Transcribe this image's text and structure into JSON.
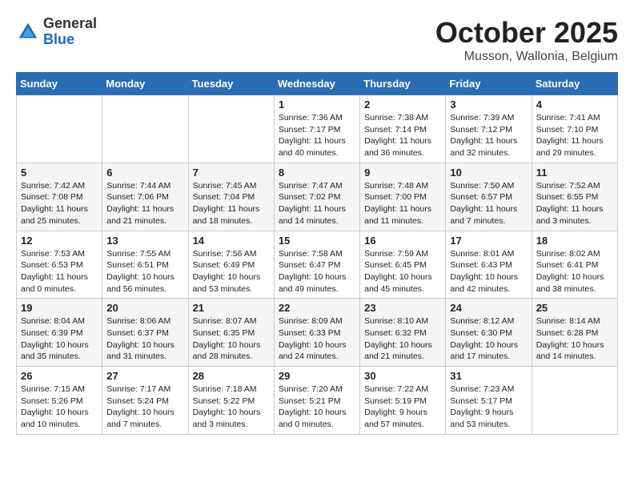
{
  "header": {
    "logo_general": "General",
    "logo_blue": "Blue",
    "month": "October 2025",
    "location": "Musson, Wallonia, Belgium"
  },
  "days_of_week": [
    "Sunday",
    "Monday",
    "Tuesday",
    "Wednesday",
    "Thursday",
    "Friday",
    "Saturday"
  ],
  "weeks": [
    [
      {
        "day": "",
        "info": ""
      },
      {
        "day": "",
        "info": ""
      },
      {
        "day": "",
        "info": ""
      },
      {
        "day": "1",
        "info": "Sunrise: 7:36 AM\nSunset: 7:17 PM\nDaylight: 11 hours and 40 minutes."
      },
      {
        "day": "2",
        "info": "Sunrise: 7:38 AM\nSunset: 7:14 PM\nDaylight: 11 hours and 36 minutes."
      },
      {
        "day": "3",
        "info": "Sunrise: 7:39 AM\nSunset: 7:12 PM\nDaylight: 11 hours and 32 minutes."
      },
      {
        "day": "4",
        "info": "Sunrise: 7:41 AM\nSunset: 7:10 PM\nDaylight: 11 hours and 29 minutes."
      }
    ],
    [
      {
        "day": "5",
        "info": "Sunrise: 7:42 AM\nSunset: 7:08 PM\nDaylight: 11 hours and 25 minutes."
      },
      {
        "day": "6",
        "info": "Sunrise: 7:44 AM\nSunset: 7:06 PM\nDaylight: 11 hours and 21 minutes."
      },
      {
        "day": "7",
        "info": "Sunrise: 7:45 AM\nSunset: 7:04 PM\nDaylight: 11 hours and 18 minutes."
      },
      {
        "day": "8",
        "info": "Sunrise: 7:47 AM\nSunset: 7:02 PM\nDaylight: 11 hours and 14 minutes."
      },
      {
        "day": "9",
        "info": "Sunrise: 7:48 AM\nSunset: 7:00 PM\nDaylight: 11 hours and 11 minutes."
      },
      {
        "day": "10",
        "info": "Sunrise: 7:50 AM\nSunset: 6:57 PM\nDaylight: 11 hours and 7 minutes."
      },
      {
        "day": "11",
        "info": "Sunrise: 7:52 AM\nSunset: 6:55 PM\nDaylight: 11 hours and 3 minutes."
      }
    ],
    [
      {
        "day": "12",
        "info": "Sunrise: 7:53 AM\nSunset: 6:53 PM\nDaylight: 11 hours and 0 minutes."
      },
      {
        "day": "13",
        "info": "Sunrise: 7:55 AM\nSunset: 6:51 PM\nDaylight: 10 hours and 56 minutes."
      },
      {
        "day": "14",
        "info": "Sunrise: 7:56 AM\nSunset: 6:49 PM\nDaylight: 10 hours and 53 minutes."
      },
      {
        "day": "15",
        "info": "Sunrise: 7:58 AM\nSunset: 6:47 PM\nDaylight: 10 hours and 49 minutes."
      },
      {
        "day": "16",
        "info": "Sunrise: 7:59 AM\nSunset: 6:45 PM\nDaylight: 10 hours and 45 minutes."
      },
      {
        "day": "17",
        "info": "Sunrise: 8:01 AM\nSunset: 6:43 PM\nDaylight: 10 hours and 42 minutes."
      },
      {
        "day": "18",
        "info": "Sunrise: 8:02 AM\nSunset: 6:41 PM\nDaylight: 10 hours and 38 minutes."
      }
    ],
    [
      {
        "day": "19",
        "info": "Sunrise: 8:04 AM\nSunset: 6:39 PM\nDaylight: 10 hours and 35 minutes."
      },
      {
        "day": "20",
        "info": "Sunrise: 8:06 AM\nSunset: 6:37 PM\nDaylight: 10 hours and 31 minutes."
      },
      {
        "day": "21",
        "info": "Sunrise: 8:07 AM\nSunset: 6:35 PM\nDaylight: 10 hours and 28 minutes."
      },
      {
        "day": "22",
        "info": "Sunrise: 8:09 AM\nSunset: 6:33 PM\nDaylight: 10 hours and 24 minutes."
      },
      {
        "day": "23",
        "info": "Sunrise: 8:10 AM\nSunset: 6:32 PM\nDaylight: 10 hours and 21 minutes."
      },
      {
        "day": "24",
        "info": "Sunrise: 8:12 AM\nSunset: 6:30 PM\nDaylight: 10 hours and 17 minutes."
      },
      {
        "day": "25",
        "info": "Sunrise: 8:14 AM\nSunset: 6:28 PM\nDaylight: 10 hours and 14 minutes."
      }
    ],
    [
      {
        "day": "26",
        "info": "Sunrise: 7:15 AM\nSunset: 5:26 PM\nDaylight: 10 hours and 10 minutes."
      },
      {
        "day": "27",
        "info": "Sunrise: 7:17 AM\nSunset: 5:24 PM\nDaylight: 10 hours and 7 minutes."
      },
      {
        "day": "28",
        "info": "Sunrise: 7:18 AM\nSunset: 5:22 PM\nDaylight: 10 hours and 3 minutes."
      },
      {
        "day": "29",
        "info": "Sunrise: 7:20 AM\nSunset: 5:21 PM\nDaylight: 10 hours and 0 minutes."
      },
      {
        "day": "30",
        "info": "Sunrise: 7:22 AM\nSunset: 5:19 PM\nDaylight: 9 hours and 57 minutes."
      },
      {
        "day": "31",
        "info": "Sunrise: 7:23 AM\nSunset: 5:17 PM\nDaylight: 9 hours and 53 minutes."
      },
      {
        "day": "",
        "info": ""
      }
    ]
  ]
}
